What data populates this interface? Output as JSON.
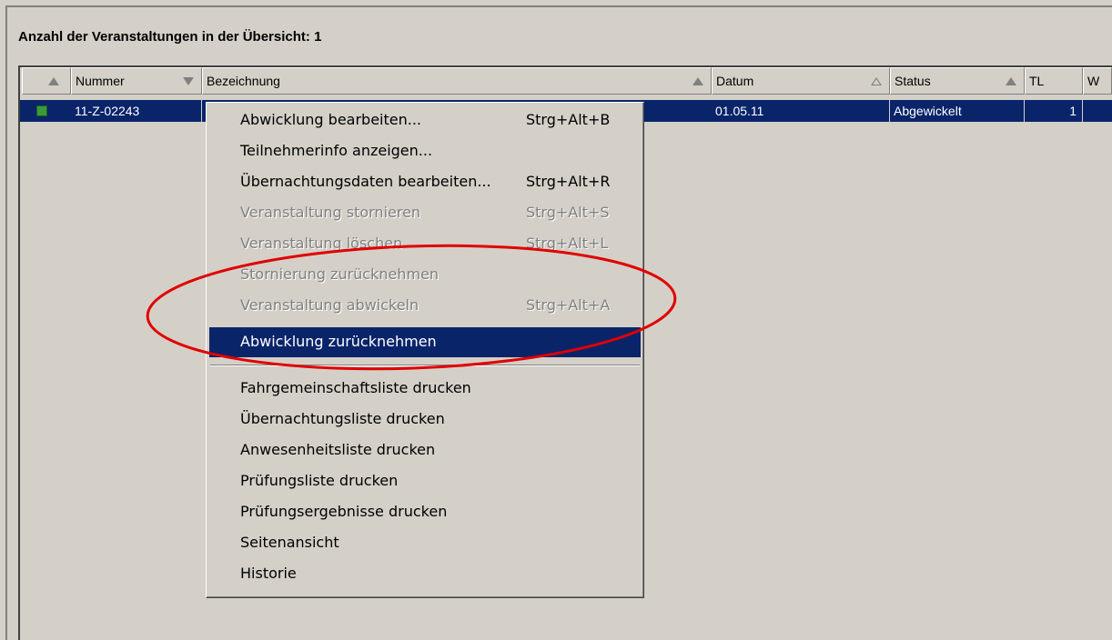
{
  "title": "Anzahl der Veranstaltungen in der Übersicht: 1",
  "columns": [
    "Nummer",
    "Bezeichnung",
    "Datum",
    "Status",
    "TL",
    "W"
  ],
  "row": {
    "nummer": "11-Z-02243",
    "datum": "01.05.11",
    "status": "Abgewickelt",
    "tl": "1",
    "status_color": "#3a9a3a"
  },
  "selection_color": "#0a246a",
  "annotation_color": "#e00000",
  "context_menu": {
    "items": [
      {
        "label": "Abwicklung bearbeiten...",
        "shortcut": "Strg+Alt+B",
        "enabled": true
      },
      {
        "label": "Teilnehmerinfo anzeigen...",
        "shortcut": "",
        "enabled": true
      },
      {
        "label": "Übernachtungsdaten bearbeiten...",
        "shortcut": "Strg+Alt+R",
        "enabled": true
      },
      {
        "label": "Veranstaltung stornieren",
        "shortcut": "Strg+Alt+S",
        "enabled": false
      },
      {
        "label": "Veranstaltung löschen",
        "shortcut": "Strg+Alt+L",
        "enabled": false
      },
      {
        "label": "Stornierung zurücknehmen",
        "shortcut": "",
        "enabled": false
      },
      {
        "label": "Veranstaltung abwickeln",
        "shortcut": "Strg+Alt+A",
        "enabled": false
      },
      {
        "label": "Abwicklung zurücknehmen",
        "shortcut": "",
        "enabled": true,
        "selected": true
      }
    ],
    "print_items": [
      {
        "label": "Fahrgemeinschaftsliste drucken"
      },
      {
        "label": "Übernachtungsliste drucken"
      },
      {
        "label": "Anwesenheitsliste drucken"
      },
      {
        "label": "Prüfungsliste drucken"
      },
      {
        "label": "Prüfungsergebnisse drucken"
      },
      {
        "label": "Seitenansicht"
      },
      {
        "label": "Historie"
      }
    ]
  }
}
